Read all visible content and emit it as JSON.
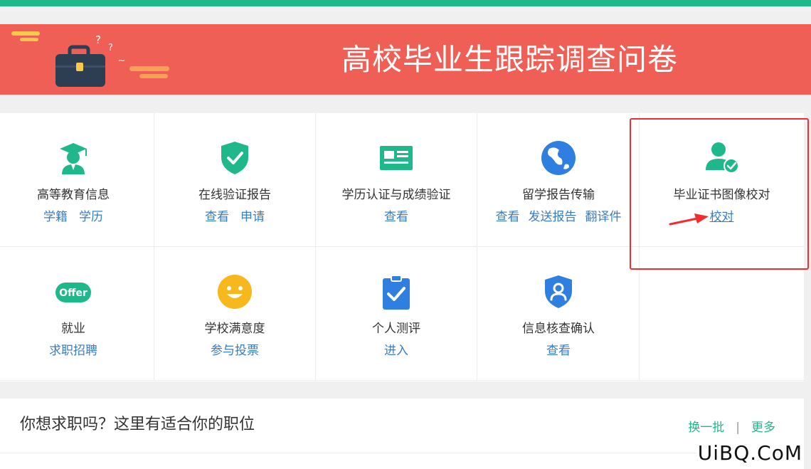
{
  "banner": {
    "title": "高校毕业生跟踪调查问卷"
  },
  "services": [
    {
      "title": "高等教育信息",
      "links": [
        "学籍",
        "学历"
      ]
    },
    {
      "title": "在线验证报告",
      "links": [
        "查看",
        "申请"
      ]
    },
    {
      "title": "学历认证与成绩验证",
      "links": [
        "查看"
      ]
    },
    {
      "title": "留学报告传输",
      "links": [
        "查看",
        "发送报告",
        "翻译件"
      ]
    },
    {
      "title": "毕业证书图像校对",
      "links": [
        "校对"
      ]
    },
    {
      "title": "就业",
      "links": [
        "求职招聘"
      ],
      "icon_text": "Offer"
    },
    {
      "title": "学校满意度",
      "links": [
        "参与投票"
      ]
    },
    {
      "title": "个人测评",
      "links": [
        "进入"
      ]
    },
    {
      "title": "信息核查确认",
      "links": [
        "查看"
      ]
    }
  ],
  "jobs": {
    "title": "你想求职吗？这里有适合你的职位",
    "refresh": "换一批",
    "separator": "|",
    "more": "更多"
  },
  "watermark": "UiBQ.CoM",
  "colors": {
    "green": "#1fb88a",
    "banner": "#ef5f55",
    "link": "#3a7dc0",
    "highlight": "#f22d2d"
  }
}
